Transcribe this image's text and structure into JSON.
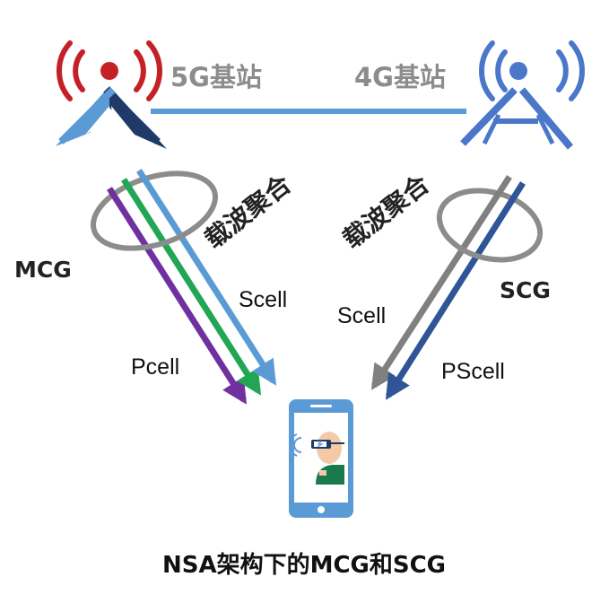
{
  "stations": {
    "left_label": "5G基站",
    "right_label": "4G基站"
  },
  "groups": {
    "mcg_label": "MCG",
    "scg_label": "SCG",
    "left_ca_label": "载波聚合",
    "right_ca_label": "载波聚合"
  },
  "cells": {
    "left_pcell": "Pcell",
    "left_scell": "Scell",
    "right_scell": "Scell",
    "right_pscell": "PScell"
  },
  "title": "NSA架构下的MCG和SCG",
  "colors": {
    "tower_red": "#c42127",
    "tower_blue": "#4a77c9",
    "link_blue": "#5b9bd5",
    "arrow_purple": "#7030a0",
    "arrow_green": "#22a655",
    "arrow_lightblue": "#5b9bd5",
    "arrow_gray": "#808080",
    "arrow_navy": "#2f5597",
    "ring_gray": "#8c8c8c"
  }
}
